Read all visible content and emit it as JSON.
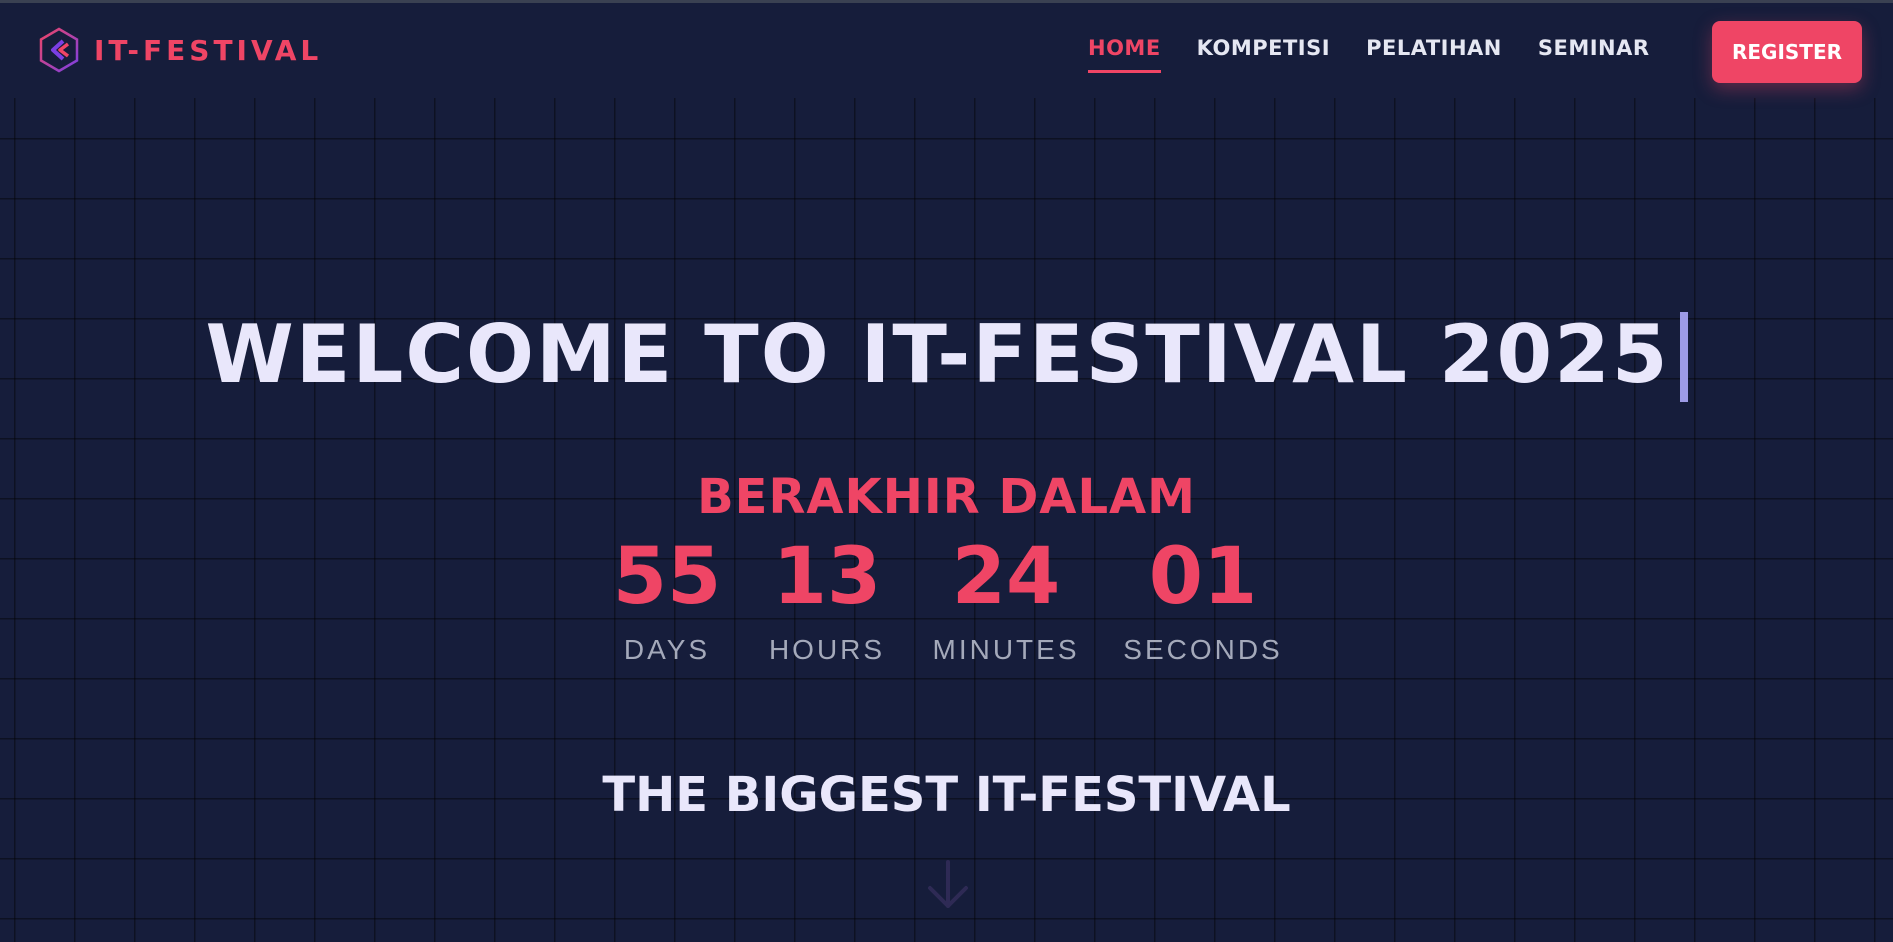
{
  "brand": {
    "name": "IT-FESTIVAL",
    "logo_icon": "hexagon-chevron-logo-icon"
  },
  "nav": {
    "items": [
      {
        "label": "HOME",
        "active": true
      },
      {
        "label": "KOMPETISI",
        "active": false
      },
      {
        "label": "PELATIHAN",
        "active": false
      },
      {
        "label": "SEMINAR",
        "active": false
      }
    ],
    "register_label": "REGISTER"
  },
  "hero": {
    "title": "WELCOME TO IT-FESTIVAL 2025",
    "countdown_title": "BERAKHIR DALAM",
    "countdown": [
      {
        "value": "55",
        "label": "DAYS"
      },
      {
        "value": "13",
        "label": "HOURS"
      },
      {
        "value": "24",
        "label": "MINUTES"
      },
      {
        "value": "01",
        "label": "SECONDS"
      }
    ],
    "tagline": "THE BIGGEST IT-FESTIVAL",
    "scroll_icon": "arrow-down-icon"
  },
  "colors": {
    "background": "#161d3b",
    "accent": "#ef4565",
    "title_text": "#e9e7fb",
    "muted_text": "#a4a9ba",
    "caret": "#9d9be6"
  }
}
